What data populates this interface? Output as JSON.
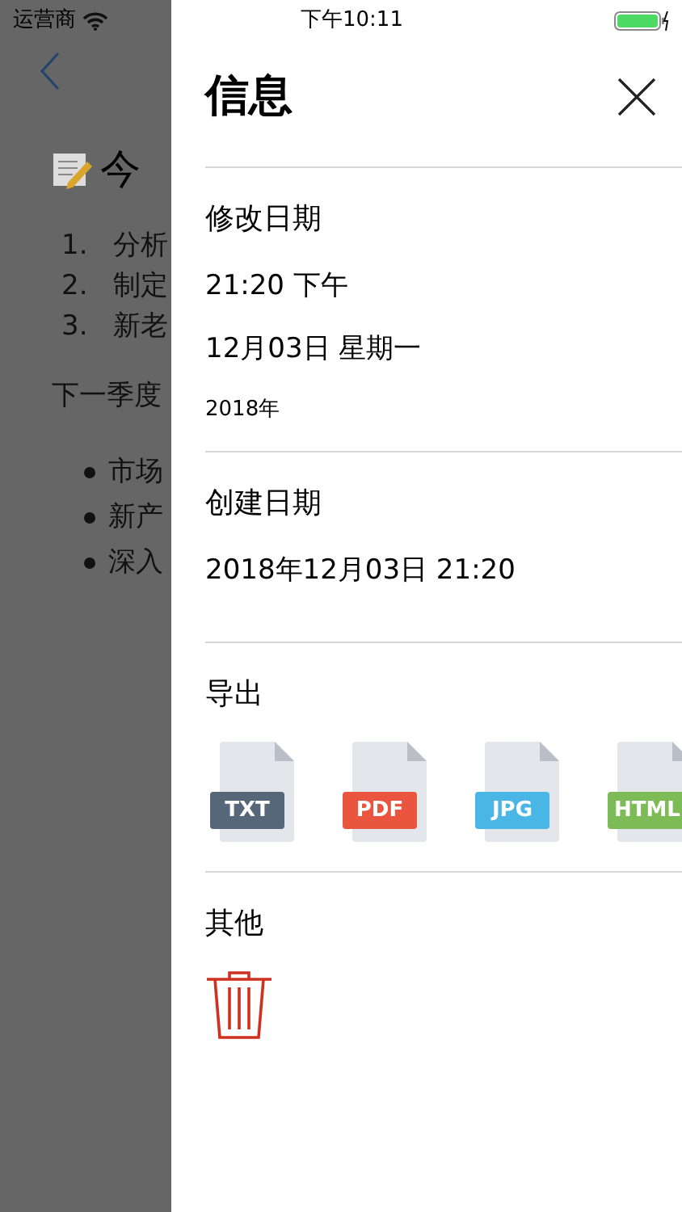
{
  "status_bar": {
    "carrier": "运营商",
    "time": "下午10:11"
  },
  "background_note": {
    "title": "今",
    "numbered_items": [
      {
        "number": "1.",
        "text": "分析"
      },
      {
        "number": "2.",
        "text": "制定"
      },
      {
        "number": "3.",
        "text": "新老"
      }
    ],
    "paragraph": "下一季度",
    "bullets": [
      "市场",
      "新产",
      "深入"
    ]
  },
  "panel": {
    "title": "信息",
    "sections": [
      {
        "kind": "lines",
        "heading": "修改日期",
        "lines": [
          {
            "text": "21:20 下午",
            "kind": "main"
          },
          {
            "text": "12月03日 星期一",
            "kind": "main"
          },
          {
            "text": "2018年",
            "kind": "minor"
          }
        ]
      },
      {
        "kind": "lines",
        "heading": "创建日期",
        "lines": [
          {
            "text": "2018年12月03日 21:20",
            "kind": "main"
          }
        ]
      },
      {
        "kind": "exports",
        "heading": "导出",
        "formats": [
          {
            "label": "TXT",
            "color": "#56677a"
          },
          {
            "label": "PDF",
            "color": "#e9553f"
          },
          {
            "label": "JPG",
            "color": "#4ab6e6"
          },
          {
            "label": "HTML",
            "color": "#7cbb55"
          }
        ]
      },
      {
        "kind": "actions",
        "heading": "其他",
        "actions": [
          {
            "kind": "delete"
          }
        ]
      }
    ]
  }
}
